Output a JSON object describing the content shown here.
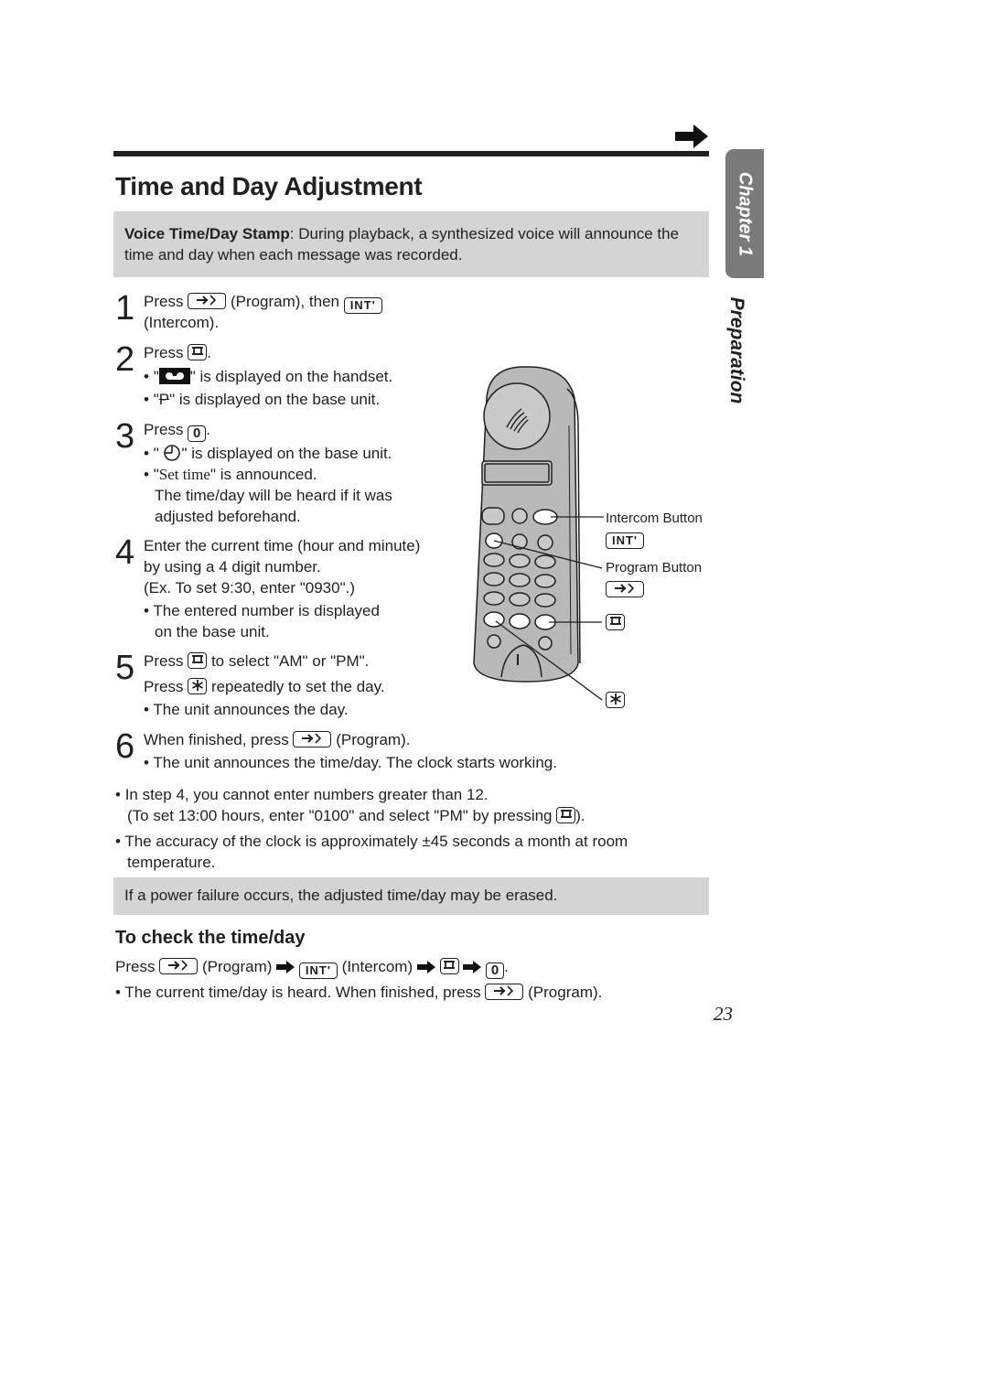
{
  "header": {
    "continue_icon": "right-arrow-icon",
    "title": "Time and Day Adjustment"
  },
  "side_tab": {
    "chapter": "Chapter 1",
    "section": "Preparation"
  },
  "voice_note": {
    "bold_label": "Voice Time/Day Stamp",
    "text": ": During playback, a synthesized voice will announce the time and day when each message was recorded."
  },
  "keys": {
    "program": "program-key-icon",
    "intercom": "INT'",
    "pause": "pause-key-icon",
    "zero": "0",
    "star": "star-key-icon"
  },
  "steps": [
    {
      "number": "1",
      "press": "Press",
      "program_label": "(Program), then",
      "intercom_label": "(Intercom)."
    },
    {
      "number": "2",
      "press": "Press",
      "end": ".",
      "bullets": [
        {
          "pre": "\"",
          "icon": "tape-icon",
          "post": "\" is displayed on the handset."
        },
        {
          "pre": "\"",
          "glyph": "P",
          "post": "\" is displayed on the base unit."
        }
      ]
    },
    {
      "number": "3",
      "press": "Press",
      "end": ".",
      "bullets": [
        {
          "pre": "\" ",
          "icon": "clock-icon",
          "post": "\" is displayed on the base unit."
        },
        {
          "pre": "\"",
          "serif": "Set time",
          "post": "\" is announced."
        }
      ],
      "extra_lines": [
        "The time/day will be heard if it was",
        "adjusted beforehand."
      ]
    },
    {
      "number": "4",
      "lines": [
        "Enter the current time (hour and minute)",
        "by using a 4 digit number.",
        "(Ex. To set 9:30, enter \"0930\".)"
      ],
      "bullet_lines": [
        "The entered number is displayed",
        "on the base unit."
      ]
    },
    {
      "number": "5",
      "press": "Press",
      "line1_post": "to select \"AM\" or \"PM\".",
      "line2_post": "repeatedly to set the day.",
      "bullet": "The unit announces the day."
    },
    {
      "number": "6",
      "pre": "When finished, press",
      "post": "(Program).",
      "bullet": "The unit announces the time/day. The clock starts working."
    }
  ],
  "notes": [
    {
      "line1": "In step 4, you cannot enter numbers greater than 12.",
      "line2_pre": "(To set 13:00 hours, enter \"0100\" and select \"PM\" by pressing",
      "line2_post": ")."
    },
    {
      "line1": "The accuracy of the clock is approximately ±45 seconds a month at room",
      "line2": "temperature."
    }
  ],
  "power_note": "If a power failure occurs, the adjusted time/day may be erased.",
  "check": {
    "title": "To check the time/day",
    "press": "Press",
    "program_label": "(Program)",
    "intercom_label": "(Intercom)",
    "end": ".",
    "bullet_pre": "The current time/day is heard. When finished, press",
    "bullet_post": "(Program)."
  },
  "illustration": {
    "intercom_label": "Intercom Button",
    "program_label": "Program Button"
  },
  "page_number": "23"
}
